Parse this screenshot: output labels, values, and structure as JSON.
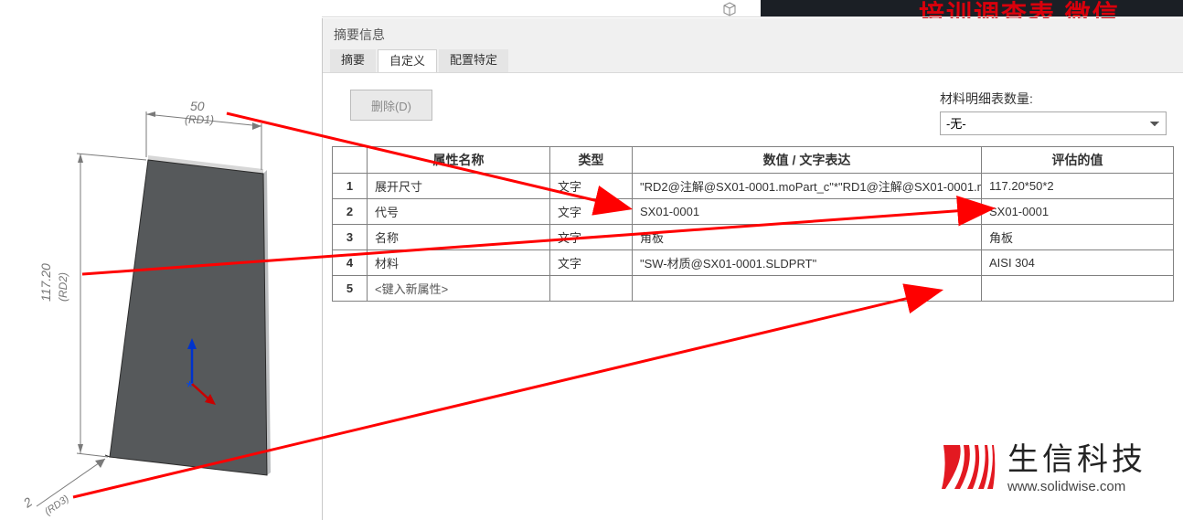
{
  "topbar": {
    "banner_text": "培训调查表 微信"
  },
  "panel": {
    "title": "摘要信息",
    "tabs": {
      "summary": "摘要",
      "custom": "自定义",
      "config": "配置特定"
    },
    "delete_label": "删除(D)",
    "bom_label": "材料明细表数量:",
    "bom_value": "-无-"
  },
  "table": {
    "headers": {
      "name": "属性名称",
      "type": "类型",
      "expr": "数值 / 文字表达",
      "eval": "评估的值"
    },
    "rows": [
      {
        "idx": "1",
        "name": "展开尺寸",
        "type": "文字",
        "expr": "\"RD2@注解@SX01-0001.moPart_c\"*\"RD1@注解@SX01-0001.m",
        "eval": "117.20*50*2"
      },
      {
        "idx": "2",
        "name": "代号",
        "type": "文字",
        "expr": "SX01-0001",
        "eval": "SX01-0001"
      },
      {
        "idx": "3",
        "name": "名称",
        "type": "文字",
        "expr": "角板",
        "eval": "角板"
      },
      {
        "idx": "4",
        "name": "材料",
        "type": "文字",
        "expr": "\"SW-材质@SX01-0001.SLDPRT\"",
        "eval": "AISI 304"
      },
      {
        "idx": "5",
        "name": "<键入新属性>",
        "type": "",
        "expr": "",
        "eval": ""
      }
    ]
  },
  "viewport": {
    "dim_width_value": "50",
    "dim_width_label": "(RD1)",
    "dim_height_value": "117.20",
    "dim_height_label": "(RD2)",
    "dim_thick_value": "2",
    "dim_thick_label": "(RD3)"
  },
  "brand": {
    "cn": "生信科技",
    "en": "www.solidwise.com"
  }
}
